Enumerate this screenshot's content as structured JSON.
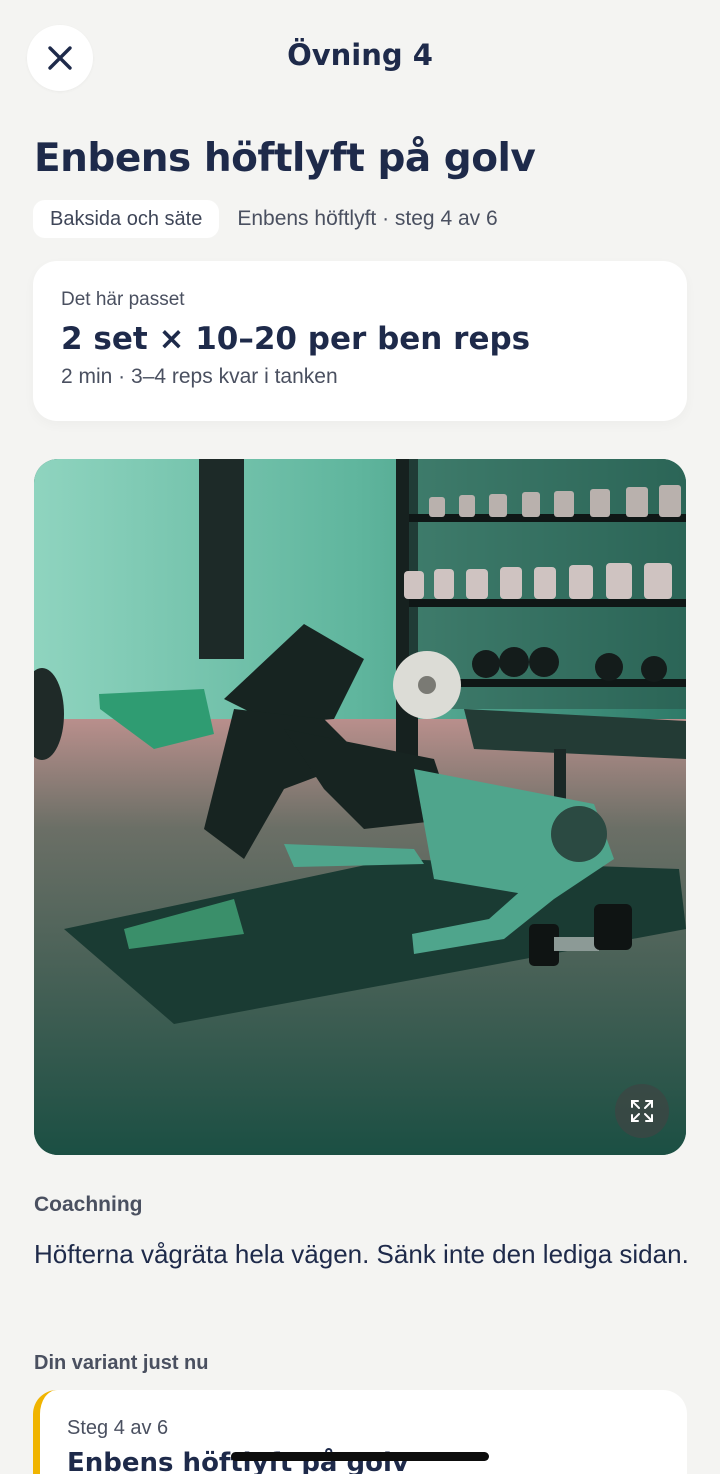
{
  "header": {
    "title": "Övning 4",
    "close_icon": "close-icon"
  },
  "exercise": {
    "title": "Enbens höftlyft på golv",
    "tag": "Baksida och säte",
    "subtitle": "Enbens höftlyft · steg 4 av 6"
  },
  "session": {
    "label": "Det här passet",
    "sets": "2 set × 10–20 per ben reps",
    "meta": "2 min · 3–4 reps kvar i tanken"
  },
  "media": {
    "icon": "expand-icon"
  },
  "coaching": {
    "label": "Coachning",
    "text": "Höfterna vågräta hela vägen. Sänk inte den lediga sidan."
  },
  "variant": {
    "label": "Din variant just nu",
    "step": "Steg 4 av 6",
    "name": "Enbens höftlyft på golv",
    "accent_color": "#f0b400"
  }
}
